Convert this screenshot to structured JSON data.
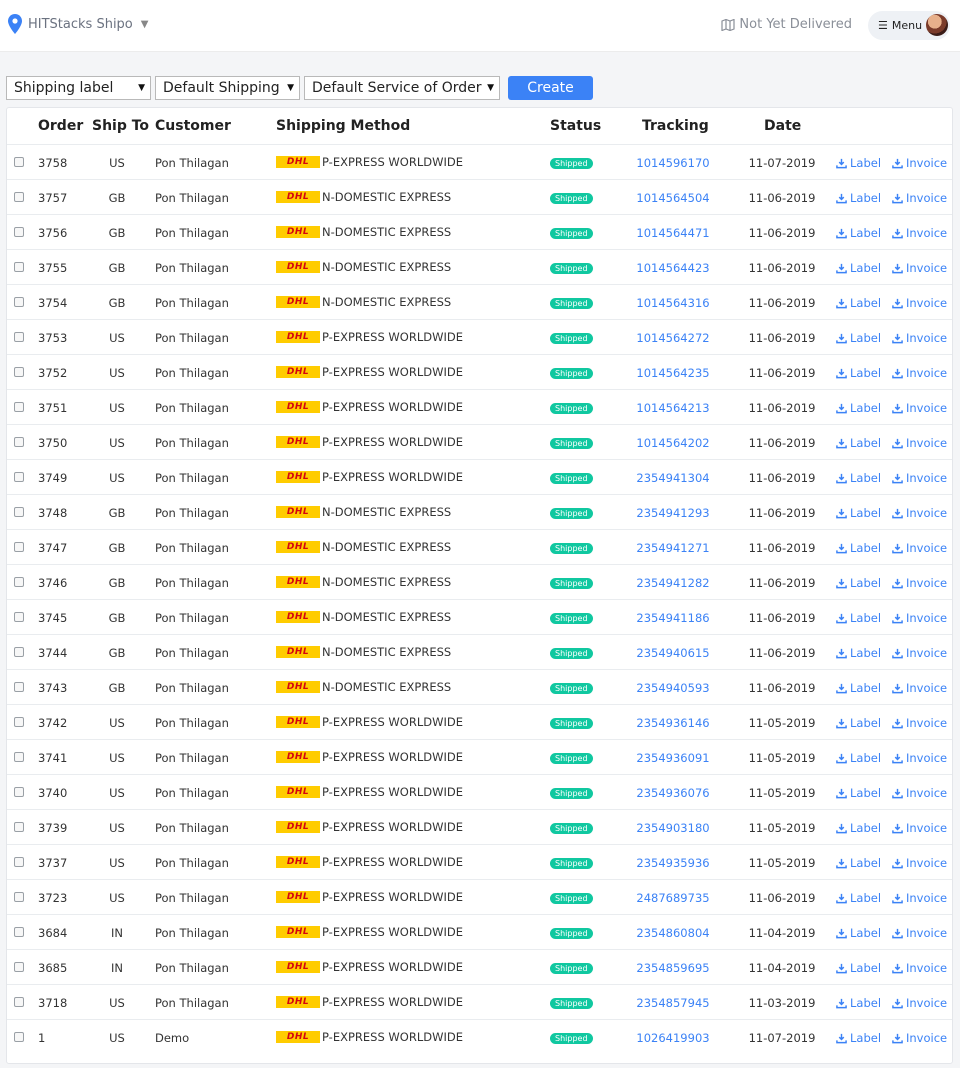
{
  "header": {
    "brand": "HITStacks Shipo",
    "status_link": "Not Yet Delivered",
    "menu_label": "Menu"
  },
  "controls": {
    "select1": "Shipping label",
    "select2": "Default Shipping",
    "select3": "Default Service of Order",
    "create_label": "Create"
  },
  "table": {
    "headers": {
      "order": "Order",
      "ship_to": "Ship To",
      "customer": "Customer",
      "method": "Shipping Method",
      "status": "Status",
      "tracking": "Tracking",
      "date": "Date"
    },
    "carrier_logo_text": "DHL",
    "label_text": "Label",
    "invoice_text": "Invoice",
    "rows": [
      {
        "order": "3758",
        "ship": "US",
        "customer": "Pon Thilagan",
        "method": "P-EXPRESS WORLDWIDE",
        "status": "Shipped",
        "tracking": "1014596170",
        "date": "11-07-2019"
      },
      {
        "order": "3757",
        "ship": "GB",
        "customer": "Pon Thilagan",
        "method": "N-DOMESTIC EXPRESS",
        "status": "Shipped",
        "tracking": "1014564504",
        "date": "11-06-2019"
      },
      {
        "order": "3756",
        "ship": "GB",
        "customer": "Pon Thilagan",
        "method": "N-DOMESTIC EXPRESS",
        "status": "Shipped",
        "tracking": "1014564471",
        "date": "11-06-2019"
      },
      {
        "order": "3755",
        "ship": "GB",
        "customer": "Pon Thilagan",
        "method": "N-DOMESTIC EXPRESS",
        "status": "Shipped",
        "tracking": "1014564423",
        "date": "11-06-2019"
      },
      {
        "order": "3754",
        "ship": "GB",
        "customer": "Pon Thilagan",
        "method": "N-DOMESTIC EXPRESS",
        "status": "Shipped",
        "tracking": "1014564316",
        "date": "11-06-2019"
      },
      {
        "order": "3753",
        "ship": "US",
        "customer": "Pon Thilagan",
        "method": "P-EXPRESS WORLDWIDE",
        "status": "Shipped",
        "tracking": "1014564272",
        "date": "11-06-2019"
      },
      {
        "order": "3752",
        "ship": "US",
        "customer": "Pon Thilagan",
        "method": "P-EXPRESS WORLDWIDE",
        "status": "Shipped",
        "tracking": "1014564235",
        "date": "11-06-2019"
      },
      {
        "order": "3751",
        "ship": "US",
        "customer": "Pon Thilagan",
        "method": "P-EXPRESS WORLDWIDE",
        "status": "Shipped",
        "tracking": "1014564213",
        "date": "11-06-2019"
      },
      {
        "order": "3750",
        "ship": "US",
        "customer": "Pon Thilagan",
        "method": "P-EXPRESS WORLDWIDE",
        "status": "Shipped",
        "tracking": "1014564202",
        "date": "11-06-2019"
      },
      {
        "order": "3749",
        "ship": "US",
        "customer": "Pon Thilagan",
        "method": "P-EXPRESS WORLDWIDE",
        "status": "Shipped",
        "tracking": "2354941304",
        "date": "11-06-2019"
      },
      {
        "order": "3748",
        "ship": "GB",
        "customer": "Pon Thilagan",
        "method": "N-DOMESTIC EXPRESS",
        "status": "Shipped",
        "tracking": "2354941293",
        "date": "11-06-2019"
      },
      {
        "order": "3747",
        "ship": "GB",
        "customer": "Pon Thilagan",
        "method": "N-DOMESTIC EXPRESS",
        "status": "Shipped",
        "tracking": "2354941271",
        "date": "11-06-2019"
      },
      {
        "order": "3746",
        "ship": "GB",
        "customer": "Pon Thilagan",
        "method": "N-DOMESTIC EXPRESS",
        "status": "Shipped",
        "tracking": "2354941282",
        "date": "11-06-2019"
      },
      {
        "order": "3745",
        "ship": "GB",
        "customer": "Pon Thilagan",
        "method": "N-DOMESTIC EXPRESS",
        "status": "Shipped",
        "tracking": "2354941186",
        "date": "11-06-2019"
      },
      {
        "order": "3744",
        "ship": "GB",
        "customer": "Pon Thilagan",
        "method": "N-DOMESTIC EXPRESS",
        "status": "Shipped",
        "tracking": "2354940615",
        "date": "11-06-2019"
      },
      {
        "order": "3743",
        "ship": "GB",
        "customer": "Pon Thilagan",
        "method": "N-DOMESTIC EXPRESS",
        "status": "Shipped",
        "tracking": "2354940593",
        "date": "11-06-2019"
      },
      {
        "order": "3742",
        "ship": "US",
        "customer": "Pon Thilagan",
        "method": "P-EXPRESS WORLDWIDE",
        "status": "Shipped",
        "tracking": "2354936146",
        "date": "11-05-2019"
      },
      {
        "order": "3741",
        "ship": "US",
        "customer": "Pon Thilagan",
        "method": "P-EXPRESS WORLDWIDE",
        "status": "Shipped",
        "tracking": "2354936091",
        "date": "11-05-2019"
      },
      {
        "order": "3740",
        "ship": "US",
        "customer": "Pon Thilagan",
        "method": "P-EXPRESS WORLDWIDE",
        "status": "Shipped",
        "tracking": "2354936076",
        "date": "11-05-2019"
      },
      {
        "order": "3739",
        "ship": "US",
        "customer": "Pon Thilagan",
        "method": "P-EXPRESS WORLDWIDE",
        "status": "Shipped",
        "tracking": "2354903180",
        "date": "11-05-2019"
      },
      {
        "order": "3737",
        "ship": "US",
        "customer": "Pon Thilagan",
        "method": "P-EXPRESS WORLDWIDE",
        "status": "Shipped",
        "tracking": "2354935936",
        "date": "11-05-2019"
      },
      {
        "order": "3723",
        "ship": "US",
        "customer": "Pon Thilagan",
        "method": "P-EXPRESS WORLDWIDE",
        "status": "Shipped",
        "tracking": "2487689735",
        "date": "11-06-2019"
      },
      {
        "order": "3684",
        "ship": "IN",
        "customer": "Pon Thilagan",
        "method": "P-EXPRESS WORLDWIDE",
        "status": "Shipped",
        "tracking": "2354860804",
        "date": "11-04-2019"
      },
      {
        "order": "3685",
        "ship": "IN",
        "customer": "Pon Thilagan",
        "method": "P-EXPRESS WORLDWIDE",
        "status": "Shipped",
        "tracking": "2354859695",
        "date": "11-04-2019"
      },
      {
        "order": "3718",
        "ship": "US",
        "customer": "Pon Thilagan",
        "method": "P-EXPRESS WORLDWIDE",
        "status": "Shipped",
        "tracking": "2354857945",
        "date": "11-03-2019"
      },
      {
        "order": "1",
        "ship": "US",
        "customer": "Demo",
        "method": "P-EXPRESS WORLDWIDE",
        "status": "Shipped",
        "tracking": "1026419903",
        "date": "11-07-2019"
      }
    ]
  },
  "colors": {
    "accent": "#3b82f6",
    "status_green": "#10c8a0",
    "dhl_yellow": "#ffcc00",
    "dhl_red": "#d40511"
  },
  "icons": [
    "map-pin-icon",
    "chevron-down-icon",
    "map-icon",
    "hamburger-icon",
    "download-icon"
  ]
}
